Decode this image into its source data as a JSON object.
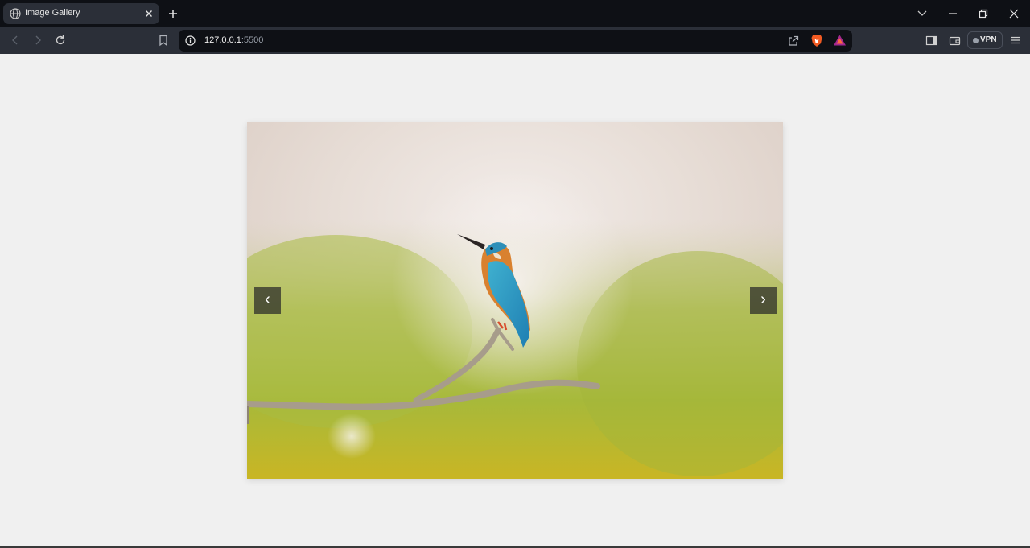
{
  "browser": {
    "tab": {
      "title": "Image Gallery",
      "favicon": "globe-icon"
    },
    "url": {
      "host": "127.0.0.1",
      "port": ":5500"
    },
    "vpn_label": "VPN"
  },
  "gallery": {
    "prev_label": "‹",
    "next_label": "›",
    "image_subject": "kingfisher-photo"
  },
  "colors": {
    "tabstrip_bg": "#0e1015",
    "toolbar_bg": "#2b2f38",
    "page_bg": "#f0f0f0",
    "arrow_bg": "#282828"
  }
}
